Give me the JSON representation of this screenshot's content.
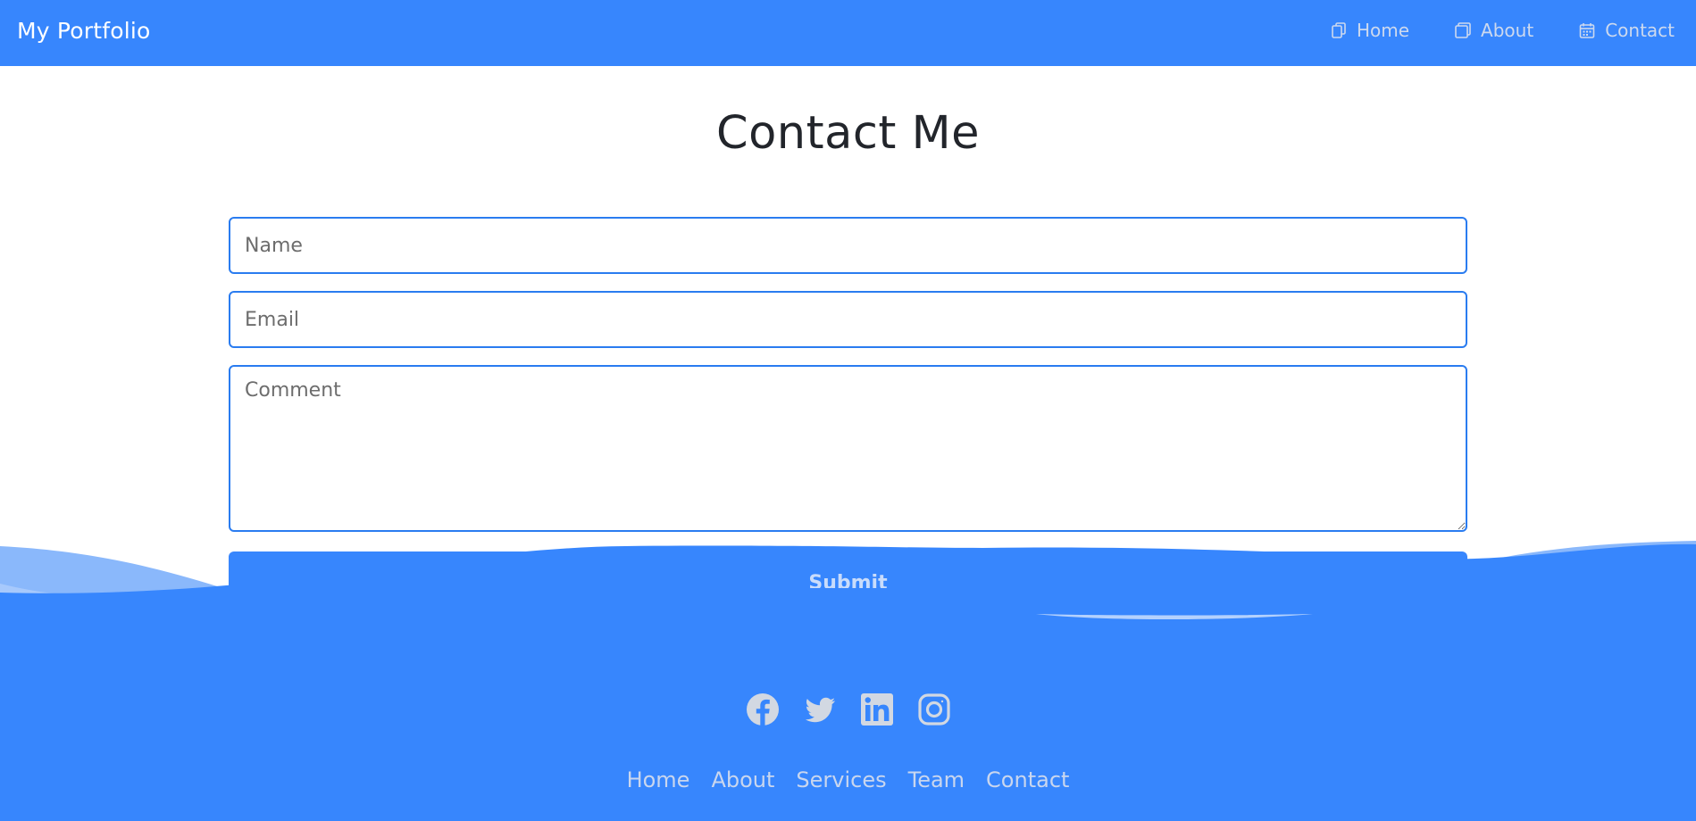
{
  "navbar": {
    "brand": "My Portfolio",
    "links": [
      {
        "label": "Home",
        "icon": "copy-icon"
      },
      {
        "label": "About",
        "icon": "window-icon"
      },
      {
        "label": "Contact",
        "icon": "calendar-icon"
      }
    ]
  },
  "main": {
    "title": "Contact Me",
    "form": {
      "name_placeholder": "Name",
      "email_placeholder": "Email",
      "comment_placeholder": "Comment",
      "submit_label": "Submit"
    }
  },
  "footer": {
    "social": [
      {
        "name": "Facebook",
        "icon": "facebook-icon"
      },
      {
        "name": "Twitter",
        "icon": "twitter-icon"
      },
      {
        "name": "LinkedIn",
        "icon": "linkedin-icon"
      },
      {
        "name": "Instagram",
        "icon": "instagram-icon"
      }
    ],
    "links": [
      "Home",
      "About",
      "Services",
      "Team",
      "Contact"
    ]
  },
  "colors": {
    "primary": "#3786fd",
    "wave_light": "#8ab8fb",
    "nav_text": "#cdd9ee",
    "title_text": "#22252b",
    "input_border": "#2a7cf0",
    "footer_icon": "#d2d8e2"
  }
}
